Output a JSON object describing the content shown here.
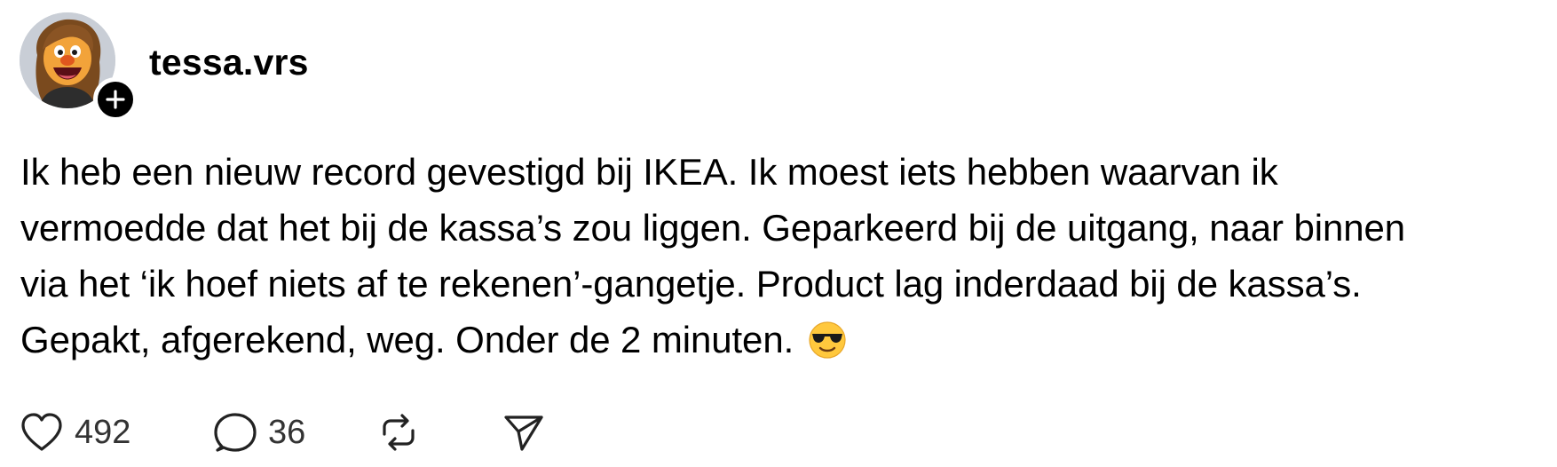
{
  "post": {
    "author": {
      "username": "tessa.vrs",
      "avatar_icon": "avatar-puppet-character",
      "follow_icon": "plus-icon"
    },
    "text_lines": [
      "Ik heb een nieuw record gevestigd bij IKEA. Ik moest iets hebben waarvan ik",
      "vermoedde dat het bij de kassa’s zou liggen. Geparkeerd bij de uitgang, naar binnen",
      "via het ‘ik hoef niets af te rekenen’-gangetje. Product lag inderdaad bij de kassa’s.",
      "Gepakt, afgerekend, weg. Onder de 2 minuten."
    ],
    "trailing_emoji": "smiling-face-with-sunglasses",
    "actions": {
      "like": {
        "icon": "heart-icon",
        "count": "492"
      },
      "reply": {
        "icon": "speech-bubble-icon",
        "count": "36"
      },
      "repost": {
        "icon": "repost-icon"
      },
      "share": {
        "icon": "send-icon"
      }
    }
  },
  "colors": {
    "text": "#000000",
    "count_text": "#333333",
    "badge": "#000000",
    "background": "#ffffff"
  }
}
